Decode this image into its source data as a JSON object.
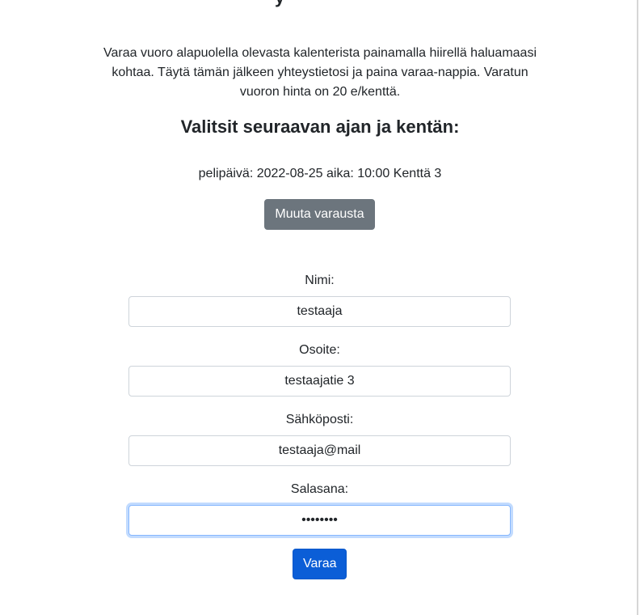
{
  "intro": {
    "text": "Varaa vuoro alapuolella olevasta kalenterista painamalla hiirellä haluamaasi kohtaa. Täytä tämän jälkeen yhteystietosi ja paina varaa-nappia. Varatun vuoron hinta on 20 e/kenttä."
  },
  "selection": {
    "title": "Valitsit seuraavan ajan ja kentän:",
    "details": "pelipäivä: 2022-08-25 aika: 10:00 Kenttä 3",
    "change_button": "Muuta varausta"
  },
  "form": {
    "name_label": "Nimi:",
    "name_value": "testaaja",
    "address_label": "Osoite:",
    "address_value": "testaajatie 3",
    "email_label": "Sähköposti:",
    "email_value": "testaaja@mail",
    "password_label": "Salasana:",
    "password_value": "salasana",
    "submit_button": "Varaa"
  },
  "colors": {
    "primary": "#0b5ed7",
    "secondary": "#6c757d",
    "focus_border": "#86b7fe"
  }
}
